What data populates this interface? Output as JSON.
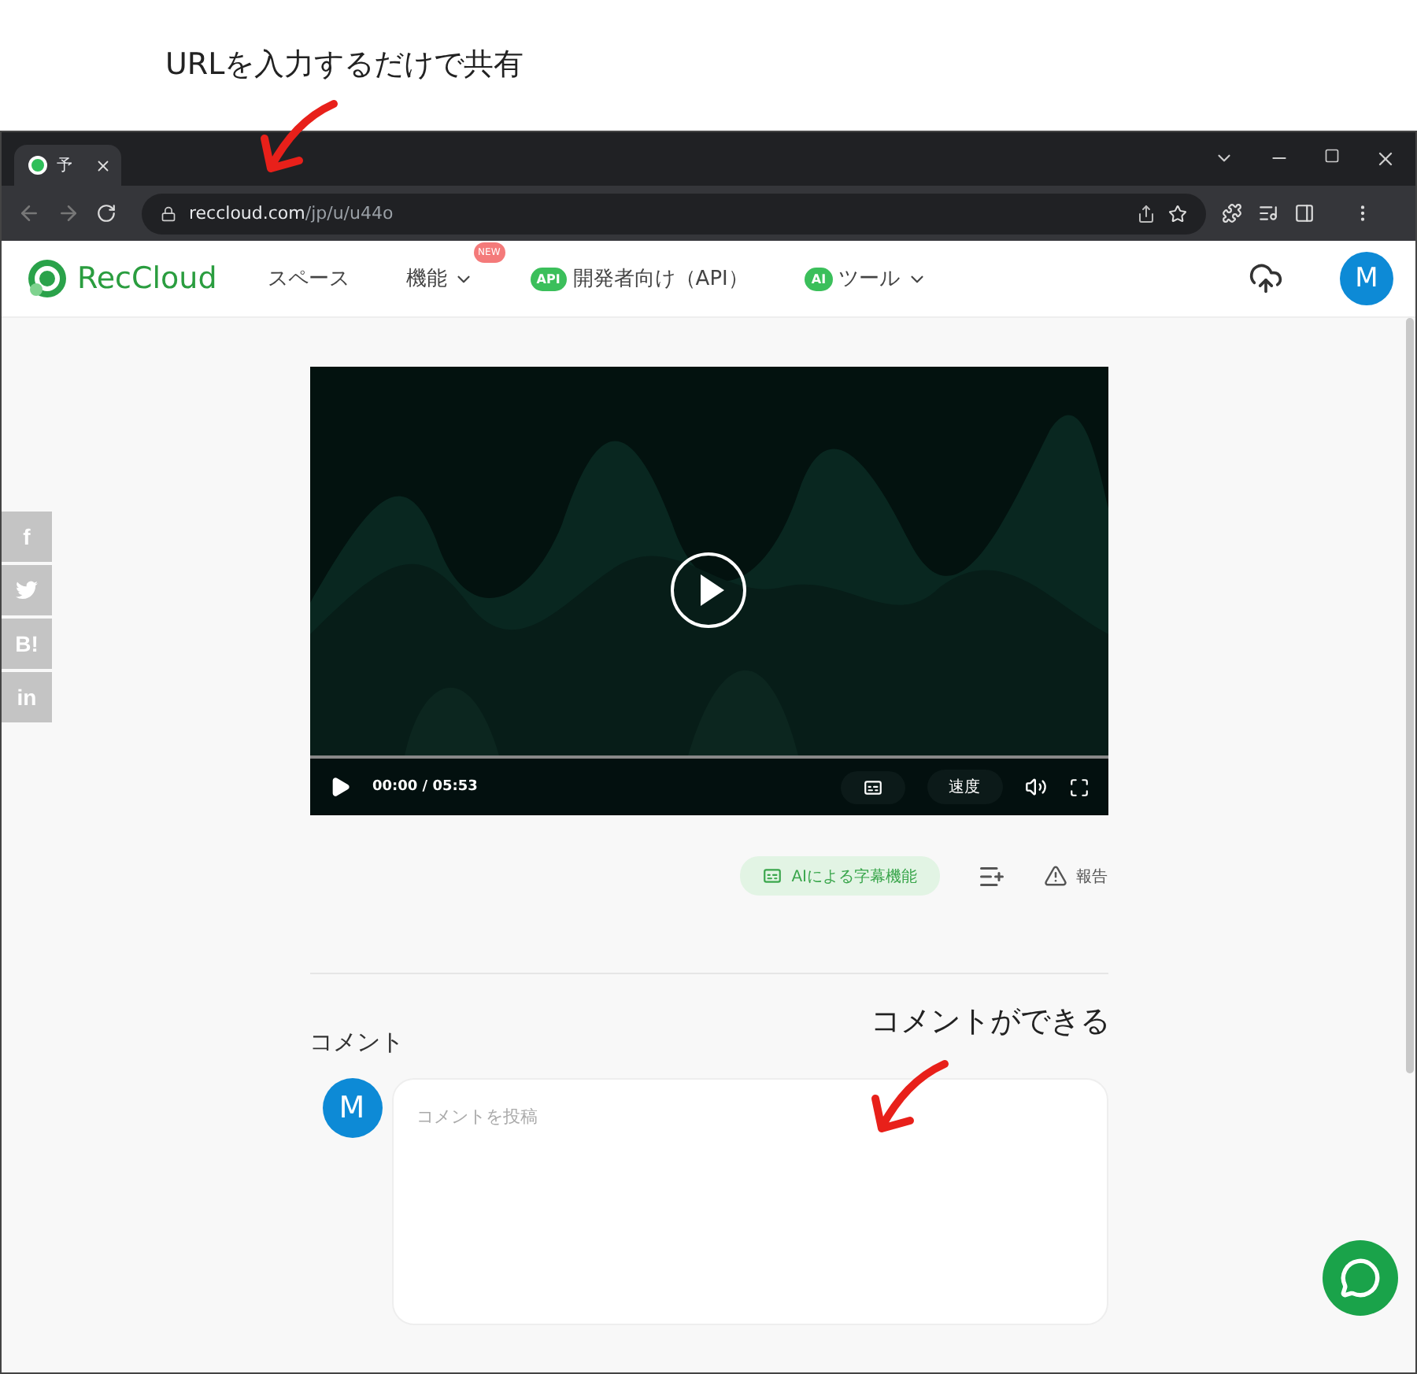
{
  "annotations": [
    {
      "text": "URLを入力するだけで共有"
    },
    {
      "text": "コメントができる"
    }
  ],
  "browser": {
    "tab": {
      "title": "予",
      "selected": true
    },
    "url": {
      "host": "reccloud.com",
      "path": "/jp/u/u44o"
    }
  },
  "site_nav": {
    "logo": "RecCloud",
    "items": [
      {
        "label": "スペース",
        "kind": "link"
      },
      {
        "label": "機能",
        "kind": "dropdown",
        "badge": "NEW"
      },
      {
        "label": "開発者向け（API）",
        "kind": "link",
        "icon_text": "API"
      },
      {
        "label": "ツール",
        "kind": "dropdown",
        "icon_text": "AI"
      }
    ],
    "avatar": "M"
  },
  "share_bar": [
    {
      "kind": "text",
      "label": "f"
    },
    {
      "kind": "bird"
    },
    {
      "kind": "text",
      "label": "B!"
    },
    {
      "kind": "text",
      "label": "in"
    }
  ],
  "video": {
    "current_time": "00:00",
    "separator": "/",
    "duration": "05:53",
    "speed": "速度"
  },
  "actions": {
    "subtitle_button": "AIによる字幕機能",
    "report": "報告"
  },
  "comments": {
    "heading": "コメント",
    "avatar": "M",
    "placeholder": "コメントを投稿"
  }
}
